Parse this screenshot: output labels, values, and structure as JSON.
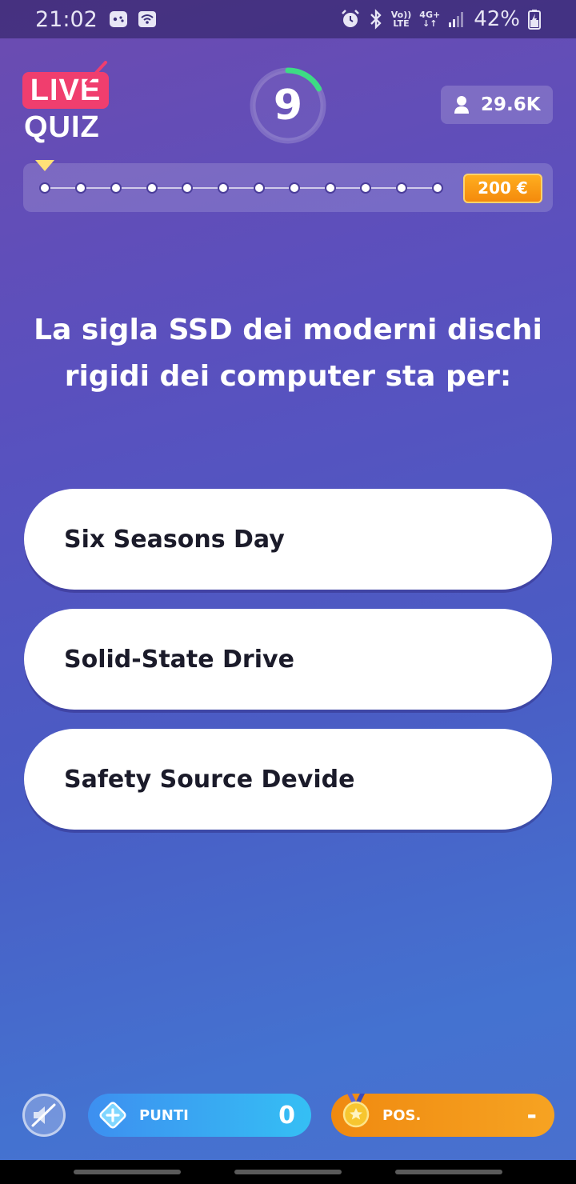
{
  "status_bar": {
    "time": "21:02",
    "battery": "42%",
    "network_top": "Vo))",
    "network_bottom": "LTE",
    "data_top": "4G+",
    "icons": [
      "game-icon",
      "wifi-icon",
      "alarm-icon",
      "bluetooth-icon",
      "signal-icon",
      "battery-icon"
    ]
  },
  "header": {
    "logo_top": "LIVE",
    "logo_bottom": "QUIZ",
    "timer": "9",
    "timer_remaining_fraction": 0.17,
    "viewers": "29.6K",
    "prize": "200 €",
    "progress_steps": 12,
    "current_step": 1
  },
  "question": {
    "text": "La sigla SSD dei moderni dischi rigidi dei computer sta per:"
  },
  "answers": [
    {
      "label": "Six Seasons Day"
    },
    {
      "label": "Solid-State Drive"
    },
    {
      "label": "Safety Source Devide"
    }
  ],
  "bottom_bar": {
    "points_label": "PUNTI",
    "points_value": "0",
    "position_label": "POS.",
    "position_value": "-"
  },
  "colors": {
    "accent_pink": "#f03e6e",
    "timer_green": "#3ddc84",
    "prize_orange": "#f59a12",
    "points_blue": "#3aa6f2",
    "position_orange": "#f39416"
  }
}
